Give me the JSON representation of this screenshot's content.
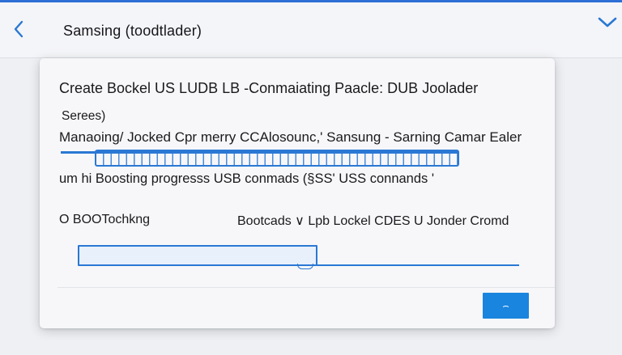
{
  "titlebar": {
    "title": "Samsing (toodtlader)",
    "back_icon": "chevron-left-icon",
    "menu_icon": "chevron-down-icon"
  },
  "dialog": {
    "heading": "Create Bockel US LUDB LB -Conmaiating Paacle: DUB Joolader",
    "series_label": "Serees)",
    "status_line": "Manaoing/ Jocked Cpr merry CCAlosounc,' Sansung - Sarning Camar Ealer",
    "boost_line": "um hi Boosting progresss USB conmads (§SS' USS connands '",
    "option_left": "O BOOTochkng",
    "option_right": "Bootcads ∨ Lpb Lockel CDES U Jonder Cromd",
    "confirm_symbol": "⌢"
  },
  "colors": {
    "accent": "#2a78d4",
    "button": "#1a85de",
    "top_bar": "#2d6fd6"
  }
}
